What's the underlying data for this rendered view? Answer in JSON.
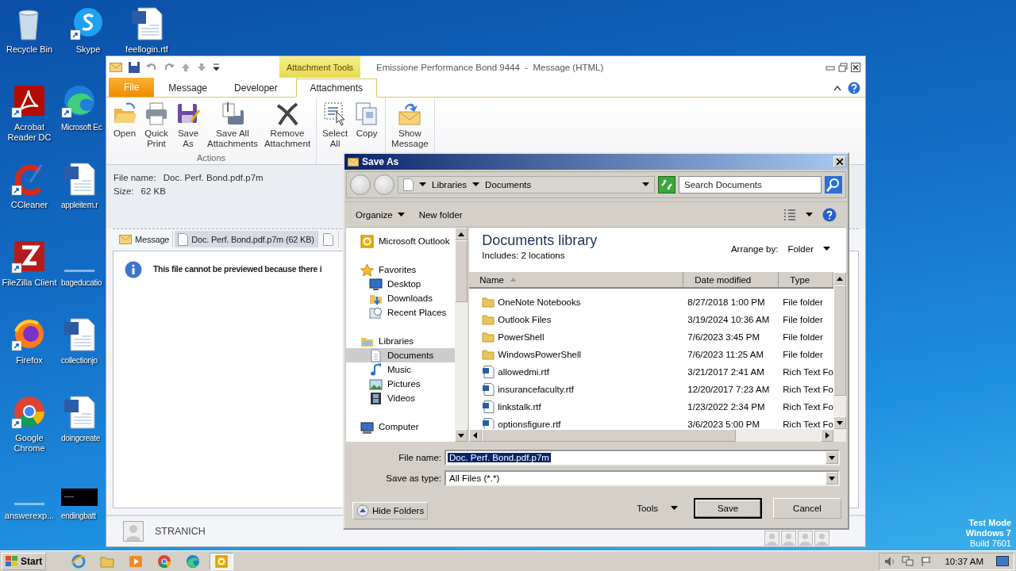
{
  "desktop": {
    "icons": [
      {
        "label": "Recycle Bin",
        "kind": "bin",
        "shortcut": false,
        "cut": false
      },
      {
        "label": "Acrobat Reader DC",
        "kind": "acrobat",
        "shortcut": true,
        "cut": false
      },
      {
        "label": "CCleaner",
        "kind": "ccleaner",
        "shortcut": true,
        "cut": false
      },
      {
        "label": "FileZilla Client",
        "kind": "filezilla",
        "shortcut": true,
        "cut": false
      },
      {
        "label": "Firefox",
        "kind": "firefox",
        "shortcut": true,
        "cut": false
      },
      {
        "label": "Google Chrome",
        "kind": "chrome",
        "shortcut": true,
        "cut": false
      },
      {
        "label": "answerexp...",
        "kind": "blank",
        "shortcut": false,
        "cut": false
      },
      {
        "label": "Skype",
        "kind": "skype",
        "shortcut": true,
        "cut": false
      },
      {
        "label": "Microsoft Ec",
        "kind": "edge",
        "shortcut": true,
        "cut": true
      },
      {
        "label": "appleitem.r",
        "kind": "word",
        "shortcut": false,
        "cut": true
      },
      {
        "label": "bageducatio",
        "kind": "blank",
        "shortcut": false,
        "cut": true
      },
      {
        "label": "collectionjo",
        "kind": "word",
        "shortcut": false,
        "cut": true
      },
      {
        "label": "doingcreate",
        "kind": "word",
        "shortcut": false,
        "cut": true
      },
      {
        "label": "endingbatt",
        "kind": "dark",
        "shortcut": false,
        "cut": true
      },
      {
        "label": "feellogin.rtf",
        "kind": "word",
        "shortcut": false,
        "cut": false
      }
    ],
    "watermark": [
      "Test Mode",
      "Windows 7",
      "Build 7601"
    ]
  },
  "outlook": {
    "contextual_tab": "Attachment Tools",
    "title": "Emissione Performance Bond 9444  -  Message (HTML)",
    "tabs": [
      {
        "label": "File",
        "kind": "file",
        "selected": false
      },
      {
        "label": "Message",
        "kind": "plain",
        "selected": false
      },
      {
        "label": "Developer",
        "kind": "plain",
        "selected": false
      },
      {
        "label": "Attachments",
        "kind": "plain",
        "selected": true
      }
    ],
    "ribbon_groups": [
      {
        "label": "Actions",
        "buttons": [
          {
            "label": "Open",
            "kind": "open"
          },
          {
            "label": "Quick\nPrint",
            "kind": "print"
          },
          {
            "label": "Save\nAs",
            "kind": "saveas"
          },
          {
            "label": "Save All\nAttachments",
            "kind": "saveall"
          },
          {
            "label": "Remove\nAttachment",
            "kind": "remove"
          }
        ]
      },
      {
        "buttons": [
          {
            "label": "Select\nAll",
            "kind": "select"
          },
          {
            "label": "Copy",
            "kind": "copy"
          }
        ]
      },
      {
        "buttons": [
          {
            "label": "Show\nMessage",
            "kind": "show"
          }
        ]
      }
    ],
    "attachment": {
      "file_name_label": "File name:",
      "file_name": "Doc. Perf. Bond.pdf.p7m",
      "size_label": "Size:",
      "size": "62 KB"
    },
    "preview_tabs": [
      {
        "label": "Message",
        "kind": "message",
        "selected": false
      },
      {
        "label": "Doc. Perf. Bond.pdf.p7m (62 KB)",
        "kind": "file",
        "selected": true
      },
      {
        "kind": "file",
        "selected": false
      }
    ],
    "preview_message": "This file cannot be previewed because there i",
    "sender": "STRANICH"
  },
  "save_dialog": {
    "title": "Save As",
    "breadcrumb": [
      "Libraries",
      "Documents"
    ],
    "search": {
      "placeholder": "Search Documents"
    },
    "toolbar": [
      {
        "label": "Organize",
        "dropdown": true
      },
      {
        "label": "New folder",
        "dropdown": false
      }
    ],
    "nav": [
      {
        "label": "Microsoft Outlook",
        "kind": "outlook",
        "selected": false
      },
      {
        "label": "Favorites",
        "kind": "star",
        "selected": false,
        "children": [
          {
            "label": "Desktop",
            "kind": "desktop",
            "selected": false
          },
          {
            "label": "Downloads",
            "kind": "downloads",
            "selected": false
          },
          {
            "label": "Recent Places",
            "kind": "recent",
            "selected": false
          }
        ]
      },
      {
        "label": "Libraries",
        "kind": "library",
        "selected": false,
        "children": [
          {
            "label": "Documents",
            "kind": "documents",
            "selected": true
          },
          {
            "label": "Music",
            "kind": "music",
            "selected": false
          },
          {
            "label": "Pictures",
            "kind": "pictures",
            "selected": false
          },
          {
            "label": "Videos",
            "kind": "videos",
            "selected": false
          }
        ]
      },
      {
        "label": "Computer",
        "kind": "computer",
        "selected": false
      }
    ],
    "library_title": "Documents library",
    "includes": "Includes:  2 locations",
    "arrange_label": "Arrange by:",
    "arrange_value": "Folder",
    "columns": [
      {
        "label": "Name",
        "sorted": true
      },
      {
        "label": "Date modified",
        "sorted": false
      },
      {
        "label": "Type",
        "sorted": false
      }
    ],
    "rows": [
      {
        "name": "OneNote Notebooks",
        "date": "8/27/2018 1:00 PM",
        "type": "File folder",
        "kind": "folder"
      },
      {
        "name": "Outlook Files",
        "date": "3/19/2024 10:36 AM",
        "type": "File folder",
        "kind": "folder"
      },
      {
        "name": "PowerShell",
        "date": "7/6/2023 3:45 PM",
        "type": "File folder",
        "kind": "folder"
      },
      {
        "name": "WindowsPowerShell",
        "date": "7/6/2023 11:25 AM",
        "type": "File folder",
        "kind": "folder"
      },
      {
        "name": "allowedmi.rtf",
        "date": "3/21/2017 2:41 AM",
        "type": "Rich Text Fo",
        "kind": "rtf"
      },
      {
        "name": "insurancefaculty.rtf",
        "date": "12/20/2017 7:23 AM",
        "type": "Rich Text Fo",
        "kind": "rtf"
      },
      {
        "name": "linkstalk.rtf",
        "date": "1/23/2022 2:34 PM",
        "type": "Rich Text Fo",
        "kind": "rtf"
      },
      {
        "name": "optionsfigure.rtf",
        "date": "3/6/2023 5:00 PM",
        "type": "Rich Text Fo",
        "kind": "rtf"
      }
    ],
    "file_name": {
      "label": "File name:",
      "value": "Doc. Perf. Bond.pdf.p7m"
    },
    "save_type": {
      "label": "Save as type:",
      "value": "All Files (*.*)"
    },
    "hide_folders": "Hide Folders",
    "tools": "Tools",
    "buttons": [
      {
        "label": "Save",
        "default": true
      },
      {
        "label": "Cancel",
        "default": false
      }
    ]
  },
  "taskbar": {
    "start": "Start",
    "apps": [
      {
        "kind": "ie",
        "active": false
      },
      {
        "kind": "explorer",
        "active": false
      },
      {
        "kind": "media",
        "active": false
      },
      {
        "kind": "chrome",
        "active": false
      },
      {
        "kind": "edge",
        "active": false
      },
      {
        "kind": "outlook",
        "active": true
      }
    ],
    "clock": "10:37 AM"
  }
}
